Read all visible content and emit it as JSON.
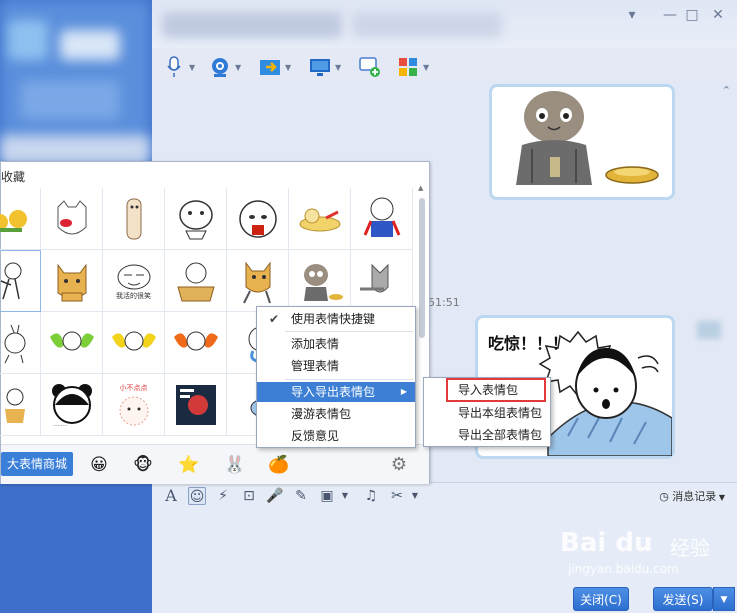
{
  "window": {
    "controls": [
      "▾",
      "—",
      "□",
      "✕"
    ]
  },
  "toolbar": {
    "buttons": [
      {
        "name": "voice-call",
        "icon": "microphone-icon"
      },
      {
        "name": "video-call",
        "icon": "camera-icon"
      },
      {
        "name": "send-file",
        "icon": "folder-arrow-icon"
      },
      {
        "name": "remote-desktop",
        "icon": "monitor-icon"
      },
      {
        "name": "create-group",
        "icon": "chat-add-icon"
      },
      {
        "name": "apps",
        "icon": "apps-icon"
      }
    ]
  },
  "chat": {
    "timestamp": "51:51",
    "message_text": "吃惊！！！"
  },
  "emoji_panel": {
    "title": "收藏",
    "captions": {
      "r2c3": "我活的很笑",
      "r4c3": "小不点点"
    },
    "store_button": "大表情商城",
    "tabs": [
      "😀",
      "🐵",
      "⭐",
      "🐰",
      "🍊"
    ]
  },
  "context_menu": {
    "items": [
      {
        "label": "使用表情快捷键",
        "checked": true
      },
      {
        "label": "添加表情"
      },
      {
        "label": "管理表情"
      },
      {
        "label": "导入导出表情包",
        "highlighted": true,
        "submenu": true
      },
      {
        "label": "漫游表情包"
      },
      {
        "label": "反馈意见"
      }
    ]
  },
  "submenu": {
    "items": [
      {
        "label": "导入表情包",
        "outlined": true
      },
      {
        "label": "导出本组表情包"
      },
      {
        "label": "导出全部表情包"
      }
    ]
  },
  "input_tools": {
    "message_log": "消息记录"
  },
  "buttons": {
    "close": "关闭(C)",
    "send": "发送(S)"
  },
  "watermark": {
    "logo": "Bai du",
    "cn": "经验",
    "url": "jingyan.baidu.com"
  }
}
